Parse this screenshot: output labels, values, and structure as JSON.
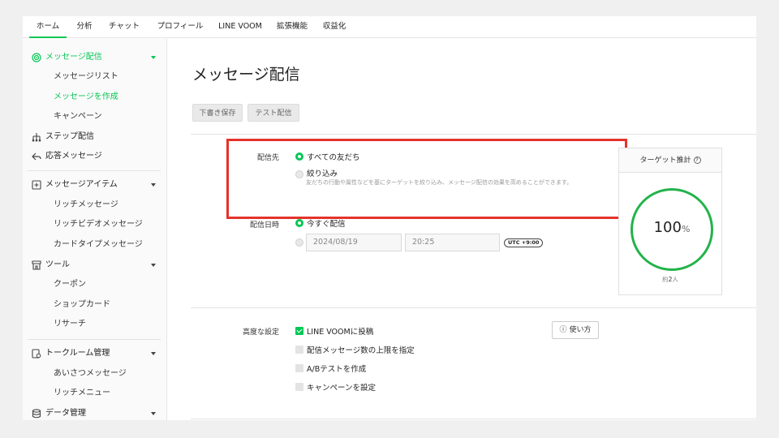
{
  "nav": {
    "tabs": [
      {
        "label": "ホーム"
      },
      {
        "label": "分析"
      },
      {
        "label": "チャット"
      },
      {
        "label": "プロフィール"
      },
      {
        "label": "LINE VOOM"
      },
      {
        "label": "拡張機能"
      },
      {
        "label": "収益化"
      }
    ],
    "active_tab": "ホーム"
  },
  "sidebar": {
    "groups": [
      {
        "label": "メッセージ配信",
        "icon": "broadcast-icon",
        "items": [
          "メッセージリスト",
          "メッセージを作成",
          "キャンペーン"
        ]
      },
      {
        "label": "ステップ配信",
        "icon": "step-icon"
      },
      {
        "label": "応答メッセージ",
        "icon": "reply-icon"
      },
      {
        "label": "メッセージアイテム",
        "icon": "message-item-icon",
        "items": [
          "リッチメッセージ",
          "リッチビデオメッセージ",
          "カードタイプメッセージ"
        ]
      },
      {
        "label": "ツール",
        "icon": "store-icon",
        "items": [
          "クーポン",
          "ショップカード",
          "リサーチ"
        ]
      },
      {
        "label": "トークルーム管理",
        "icon": "talkroom-icon",
        "items": [
          "あいさつメッセージ",
          "リッチメニュー"
        ]
      },
      {
        "label": "データ管理",
        "icon": "database-icon"
      }
    ],
    "active_item": "メッセージを作成"
  },
  "main": {
    "title": "メッセージ配信",
    "draft_button": "下書き保存",
    "test_button": "テスト配信",
    "recipients": {
      "label": "配信先",
      "option_all": "すべての友だち",
      "option_filter": "絞り込み",
      "filter_hint": "友だちの行動や属性などを基にターゲットを絞り込み、メッセージ配信の効果を高めることができます。"
    },
    "schedule": {
      "label": "配信日時",
      "option_now": "今すぐ配信",
      "date": "2024/08/19",
      "time": "20:25",
      "timezone": "UTC +9:00"
    },
    "target": {
      "title": "ターゲット推計",
      "percent": "100",
      "percent_unit": "%",
      "reach_prefix": "約",
      "reach_count": "2",
      "reach_suffix": "人"
    },
    "advanced": {
      "label": "高度な設定",
      "usage_button": "使い方",
      "options": [
        {
          "label": "LINE VOOMに投稿",
          "checked": true
        },
        {
          "label": "配信メッセージ数の上限を指定",
          "checked": false
        },
        {
          "label": "A/Bテストを作成",
          "checked": false
        },
        {
          "label": "キャンペーンを設定",
          "checked": false
        }
      ]
    }
  },
  "colors": {
    "accent": "#06c755",
    "highlight": "#e5332a"
  }
}
